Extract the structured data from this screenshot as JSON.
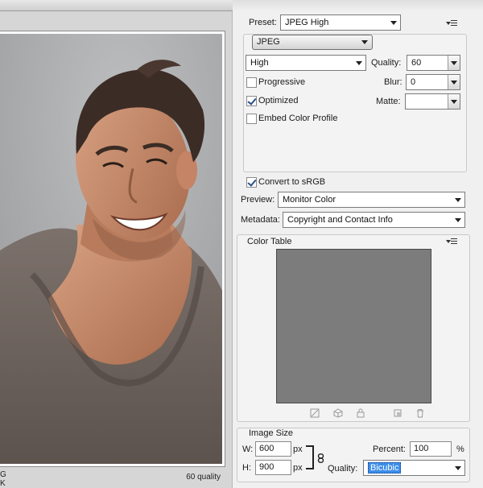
{
  "preview": {
    "status_left_line1": "G",
    "status_left_line2": "K",
    "status_right": "60 quality"
  },
  "settings": {
    "preset_label": "Preset:",
    "preset_value": "JPEG High",
    "format_value": "JPEG",
    "compression_value": "High",
    "quality_label": "Quality:",
    "quality_value": "60",
    "progressive_label": "Progressive",
    "progressive_checked": false,
    "blur_label": "Blur:",
    "blur_value": "0",
    "optimized_label": "Optimized",
    "optimized_checked": true,
    "matte_label": "Matte:",
    "matte_value": "",
    "embed_label": "Embed Color Profile",
    "embed_checked": false,
    "convert_label": "Convert to sRGB",
    "convert_checked": true,
    "preview_label": "Preview:",
    "preview_value": "Monitor Color",
    "metadata_label": "Metadata:",
    "metadata_value": "Copyright and Contact Info"
  },
  "color_table": {
    "title": "Color Table",
    "swatch_color": "#7c7c7c"
  },
  "image_size": {
    "title": "Image Size",
    "w_label": "W:",
    "w_value": "600",
    "w_unit": "px",
    "h_label": "H:",
    "h_value": "900",
    "h_unit": "px",
    "percent_label": "Percent:",
    "percent_value": "100",
    "percent_unit": "%",
    "quality_label": "Quality:",
    "quality_value": "Bicubic"
  },
  "icons": {
    "panel_menu": "panel-menu-icon",
    "link": "link-icon",
    "trash": "trash-icon"
  },
  "colors": {
    "accent_selection": "#3d8ee8",
    "checkmark": "#2b4e8c"
  }
}
